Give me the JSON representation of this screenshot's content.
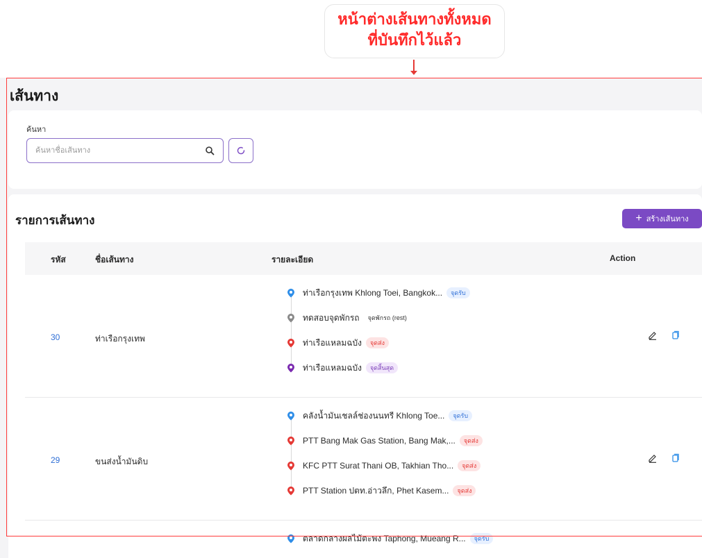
{
  "annotation": {
    "line1": "หน้าต่างเส้นทางทั้งหมด",
    "line2": "ที่บันทึกไว้แล้ว"
  },
  "page": {
    "title": "เส้นทาง"
  },
  "search": {
    "label": "ค้นหา",
    "placeholder": "ค้นหาชื่อเส้นทาง",
    "value": ""
  },
  "list": {
    "title": "รายการเส้นทาง",
    "create_label": "สร้างเส้นทาง",
    "columns": {
      "code": "รหัส",
      "name": "ชื่อเส้นทาง",
      "detail": "รายละเอียด",
      "action": "Action"
    }
  },
  "routes": [
    {
      "code": "30",
      "name": "ท่าเรือกรุงเทพ",
      "stops": [
        {
          "label": "ท่าเรือกรุงเทพ Khlong Toei, Bangkok...",
          "tag": "จุดรับ",
          "type": "pickup",
          "color": "#2f8ee8"
        },
        {
          "label": "ทดสอบจุดพักรถ",
          "tag": "จุดพักรถ (rest)",
          "type": "rest",
          "color": "#8a8a8a"
        },
        {
          "label": "ท่าเรือแหลมฉบัง",
          "tag": "จุดส่ง",
          "type": "drop",
          "color": "#e53935"
        },
        {
          "label": "ท่าเรือแหลมฉบัง",
          "tag": "จุดสิ้นสุด",
          "type": "end",
          "color": "#7b2bb0"
        }
      ]
    },
    {
      "code": "29",
      "name": "ขนส่งน้ำมันดิบ",
      "stops": [
        {
          "label": "คลังน้ำมันเชลล์ช่องนนทรี Khlong Toe...",
          "tag": "จุดรับ",
          "type": "pickup",
          "color": "#2f8ee8"
        },
        {
          "label": "PTT Bang Mak Gas Station, Bang Mak,...",
          "tag": "จุดส่ง",
          "type": "drop",
          "color": "#e53935"
        },
        {
          "label": "KFC PTT Surat Thani OB, Takhian Tho...",
          "tag": "จุดส่ง",
          "type": "drop",
          "color": "#e53935"
        },
        {
          "label": "PTT Station ปตท.อ่าวลึก, Phet Kasem...",
          "tag": "จุดส่ง",
          "type": "drop",
          "color": "#e53935"
        }
      ]
    },
    {
      "code": "",
      "name": "",
      "stops": [
        {
          "label": "ตลาดกลางผลไม้ตะพง Taphong, Mueang R...",
          "tag": "จุดรับ",
          "type": "pickup",
          "color": "#2f8ee8"
        }
      ]
    }
  ],
  "icons": {
    "search": "search-icon",
    "refresh": "refresh-icon",
    "plus": "plus-icon",
    "edit": "pencil-icon",
    "copy": "copy-icon",
    "pin": "map-pin-icon"
  },
  "colors": {
    "accent": "#7b4ac4",
    "highlight": "#ff3b3b",
    "link": "#2f6fd6"
  }
}
